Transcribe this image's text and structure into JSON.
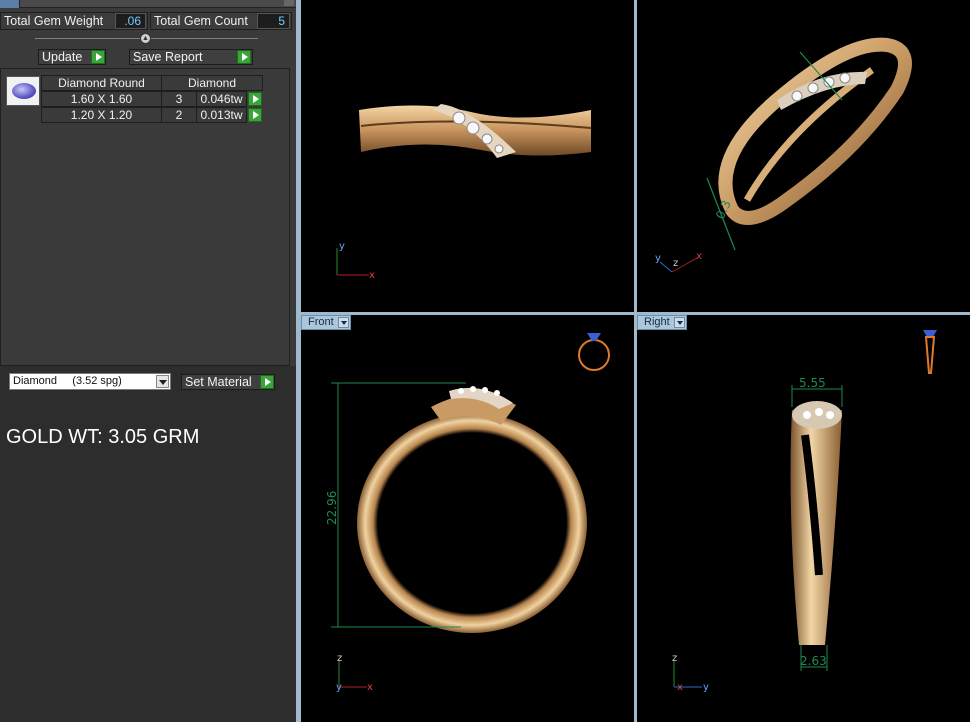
{
  "left_panel": {
    "total_gem_weight_label": "Total Gem Weight",
    "total_gem_weight_value": ".06",
    "total_gem_count_label": "Total Gem Count",
    "total_gem_count_value": "5",
    "update_label": "Update",
    "save_report_label": "Save Report",
    "gem_table": {
      "headers": [
        "Diamond Round",
        "Diamond"
      ],
      "rows": [
        {
          "size": "1.60 X 1.60",
          "count": "3",
          "weight": "0.046tw"
        },
        {
          "size": "1.20 X 1.20",
          "count": "2",
          "weight": "0.013tw"
        }
      ]
    },
    "material_select": "Diamond     (3.52 spg)",
    "set_material_label": "Set Material",
    "gold_weight_text": "GOLD WT: 3.05 GRM"
  },
  "viewports": {
    "top_left": {
      "axes": [
        "y",
        "x"
      ]
    },
    "top_right": {
      "axes": [
        "y",
        "z",
        "x"
      ],
      "dimension": "0.3"
    },
    "front": {
      "label": "Front",
      "dimension": "22.96",
      "axes": [
        "z",
        "y",
        "x"
      ]
    },
    "right": {
      "label": "Right",
      "dimension_top": "5.55",
      "dimension_bottom": "2.63",
      "axes": [
        "z",
        "x",
        "y"
      ]
    }
  },
  "colors": {
    "viewport_bg": "#000000",
    "panel_bg": "#3a3a3a",
    "accent_blue": "#78c8ff",
    "go_green": "#3aa33a",
    "dimension_green": "#1d8a52",
    "gold": "#d9b07a"
  },
  "icons": [
    "go-arrow-icon",
    "dropdown-arrow-icon",
    "diamond-round-icon",
    "ring-orientation-icon",
    "ring-side-icon"
  ]
}
